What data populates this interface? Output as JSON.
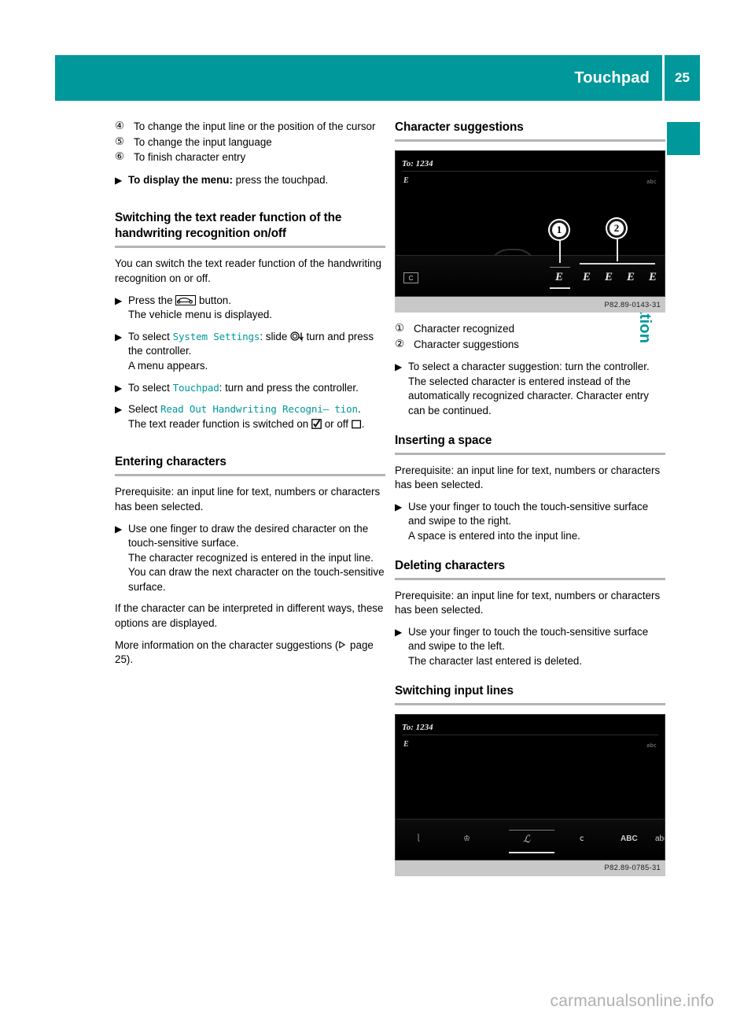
{
  "header": {
    "title": "Touchpad",
    "page_number": "25"
  },
  "chapter_tab": {
    "label": "Overview and operation"
  },
  "footer": {
    "watermark": "carmanualsonline.info"
  },
  "left_column": {
    "legend": [
      {
        "num": "④",
        "text": "To change the input line or the position of the cursor"
      },
      {
        "num": "⑤",
        "text": "To change the input language"
      },
      {
        "num": "⑥",
        "text": "To finish character entry"
      }
    ],
    "step_display_menu": {
      "bold_label": "To display the menu:",
      "rest": " press the touchpad."
    },
    "section_text_reader": {
      "heading": "Switching the text reader function of the handwriting recognition on/off",
      "intro": "You can switch the text reader function of the handwriting recognition on or off.",
      "step_press_pre": "Press the ",
      "step_press_post": " button.",
      "step_press_result": "The vehicle menu is displayed.",
      "step_system_pre": "To select ",
      "step_system_menu": "System Settings",
      "step_system_mid": ": slide ",
      "step_system_post": ", turn and press the controller.",
      "step_system_result": "A menu appears.",
      "step_touchpad_pre": "To select ",
      "step_touchpad_menu": "Touchpad",
      "step_touchpad_post": ": turn and press the controller.",
      "step_select_pre": "Select ",
      "step_select_menu": "Read Out Handwriting Recogni– tion",
      "step_select_post": ".",
      "step_select_result_pre": "The text reader function is switched on ",
      "step_select_result_mid": " or off ",
      "step_select_result_post": "."
    },
    "section_entering": {
      "heading": "Entering characters",
      "prerequisite": "Prerequisite: an input line for text, numbers or characters has been selected.",
      "step_draw": "Use one finger to draw the desired character on the touch-sensitive surface.",
      "step_draw_result": "The character recognized is entered in the input line. You can draw the next character on the touch-sensitive surface.",
      "para_interpret": "If the character can be interpreted in different ways, these options are displayed.",
      "para_more_pre": "More information on the character suggestions (",
      "para_more_post": " page 25)."
    }
  },
  "right_column": {
    "section_suggestions": {
      "heading": "Character suggestions",
      "figure": {
        "code": "P82.89-0143-31",
        "to_line": "To: 1234",
        "language_indicator": "E",
        "right_indicator": "abc",
        "abc_button": "C",
        "callout_1": "1",
        "callout_2": "2",
        "recognized_char": "E",
        "suggestion_chars": [
          "E",
          "E",
          "E",
          "E"
        ]
      },
      "legend": [
        {
          "num": "①",
          "text": "Character recognized"
        },
        {
          "num": "②",
          "text": "Character suggestions"
        }
      ],
      "step_select": "To select a character suggestion: turn the controller.",
      "step_select_result": "The selected character is entered instead of the automatically recognized character. Character entry can be continued."
    },
    "section_space": {
      "heading": "Inserting a space",
      "prerequisite": "Prerequisite: an input line for text, numbers or characters has been selected.",
      "step": "Use your finger to touch the touch-sensitive surface and swipe to the right.",
      "step_result": "A space is entered into the input line."
    },
    "section_delete": {
      "heading": "Deleting characters",
      "prerequisite": "Prerequisite: an input line for text, numbers or characters has been selected.",
      "step": "Use your finger to touch the touch-sensitive surface and swipe to the left.",
      "step_result": "The character last entered is deleted."
    },
    "section_switching": {
      "heading": "Switching input lines",
      "figure": {
        "code": "P82.89-0785-31",
        "to_line": "To: 1234",
        "language_indicator": "E",
        "right_indicator": "abc"
      }
    }
  },
  "colors": {
    "teal": "#00989a",
    "rule_gray": "#b4b4b4",
    "caption_gray": "#c8c8c8"
  }
}
